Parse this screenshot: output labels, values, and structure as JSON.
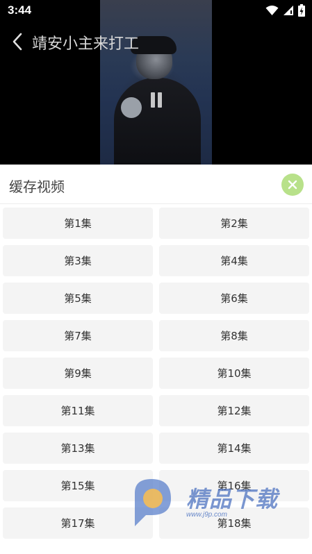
{
  "status_bar": {
    "time": "3:44",
    "icons": [
      "wifi-icon",
      "signal-icon",
      "battery-charging-icon"
    ]
  },
  "video": {
    "title": "靖安小主来打工",
    "state_icon": "pause-icon",
    "back_icon": "chevron-left-icon"
  },
  "panel": {
    "title": "缓存视频",
    "close_icon": "close-icon",
    "accent_color": "#b8e18a",
    "episodes": [
      {
        "label": "第1集"
      },
      {
        "label": "第2集"
      },
      {
        "label": "第3集"
      },
      {
        "label": "第4集"
      },
      {
        "label": "第5集"
      },
      {
        "label": "第6集"
      },
      {
        "label": "第7集"
      },
      {
        "label": "第8集"
      },
      {
        "label": "第9集"
      },
      {
        "label": "第10集"
      },
      {
        "label": "第11集"
      },
      {
        "label": "第12集"
      },
      {
        "label": "第13集"
      },
      {
        "label": "第14集"
      },
      {
        "label": "第15集"
      },
      {
        "label": "第16集"
      },
      {
        "label": "第17集"
      },
      {
        "label": "第18集"
      }
    ]
  },
  "watermark": {
    "brand": "精品下载",
    "url": "www.j9p.com"
  }
}
